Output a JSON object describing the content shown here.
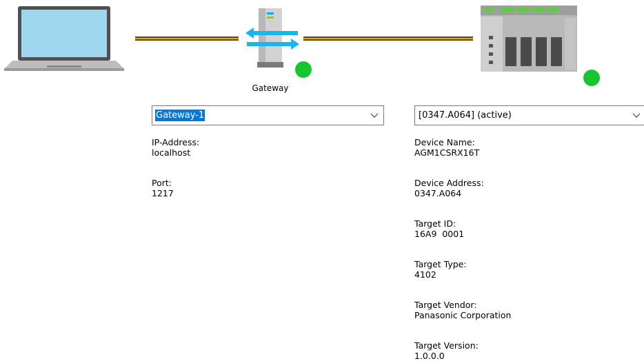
{
  "topology": {
    "gateway_caption": "Gateway",
    "gateway_status_color": "#18c42f",
    "device_status_color": "#18c42f",
    "cable_color": "#f0a800",
    "laptop_icon": "laptop-icon",
    "gateway_icon": "gateway-server-icon",
    "plc_icon": "plc-rack-icon"
  },
  "gateway_panel": {
    "selector": {
      "value": "Gateway-1"
    },
    "properties": [
      {
        "label": "IP-Address:",
        "value": "localhost"
      },
      {
        "label": "Port:",
        "value": "1217"
      }
    ]
  },
  "device_panel": {
    "selector": {
      "value": "[0347.A064] (active)"
    },
    "properties": [
      {
        "label": "Device Name:",
        "value": "AGM1CSRX16T"
      },
      {
        "label": "Device Address:",
        "value": "0347.A064"
      },
      {
        "label": "Target ID:",
        "value": "16A9  0001"
      },
      {
        "label": "Target Type:",
        "value": "4102"
      },
      {
        "label": "Target Vendor:",
        "value": "Panasonic Corporation"
      },
      {
        "label": "Target Version:",
        "value": "1.0.0.0"
      }
    ]
  }
}
